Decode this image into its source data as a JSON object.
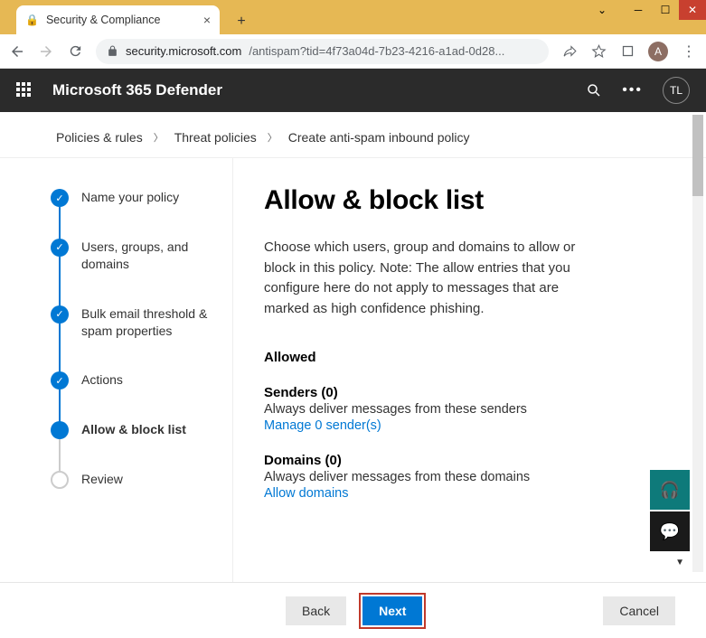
{
  "window": {
    "tab_title": "Security & Compliance",
    "url_host": "security.microsoft.com",
    "url_path": "/antispam?tid=4f73a04d-7b23-4216-a1ad-0d28...",
    "avatar_letter": "A"
  },
  "header": {
    "brand": "Microsoft 365 Defender",
    "user_initials": "TL"
  },
  "breadcrumb": {
    "items": [
      "Policies & rules",
      "Threat policies",
      "Create anti-spam inbound policy"
    ]
  },
  "wizard": {
    "steps": [
      {
        "label": "Name your policy",
        "state": "done"
      },
      {
        "label": "Users, groups, and domains",
        "state": "done"
      },
      {
        "label": "Bulk email threshold & spam properties",
        "state": "done"
      },
      {
        "label": "Actions",
        "state": "done"
      },
      {
        "label": "Allow & block list",
        "state": "current"
      },
      {
        "label": "Review",
        "state": "pending"
      }
    ]
  },
  "main": {
    "title": "Allow & block list",
    "description": "Choose which users, group and domains to allow or block in this policy. Note: The allow entries that you configure here do not apply to messages that are marked as high confidence phishing.",
    "allowed_heading": "Allowed",
    "senders": {
      "heading": "Senders (0)",
      "text": "Always deliver messages from these senders",
      "link": "Manage 0 sender(s)"
    },
    "domains": {
      "heading": "Domains (0)",
      "text": "Always deliver messages from these domains",
      "link": "Allow domains"
    }
  },
  "footer": {
    "back": "Back",
    "next": "Next",
    "cancel": "Cancel"
  }
}
